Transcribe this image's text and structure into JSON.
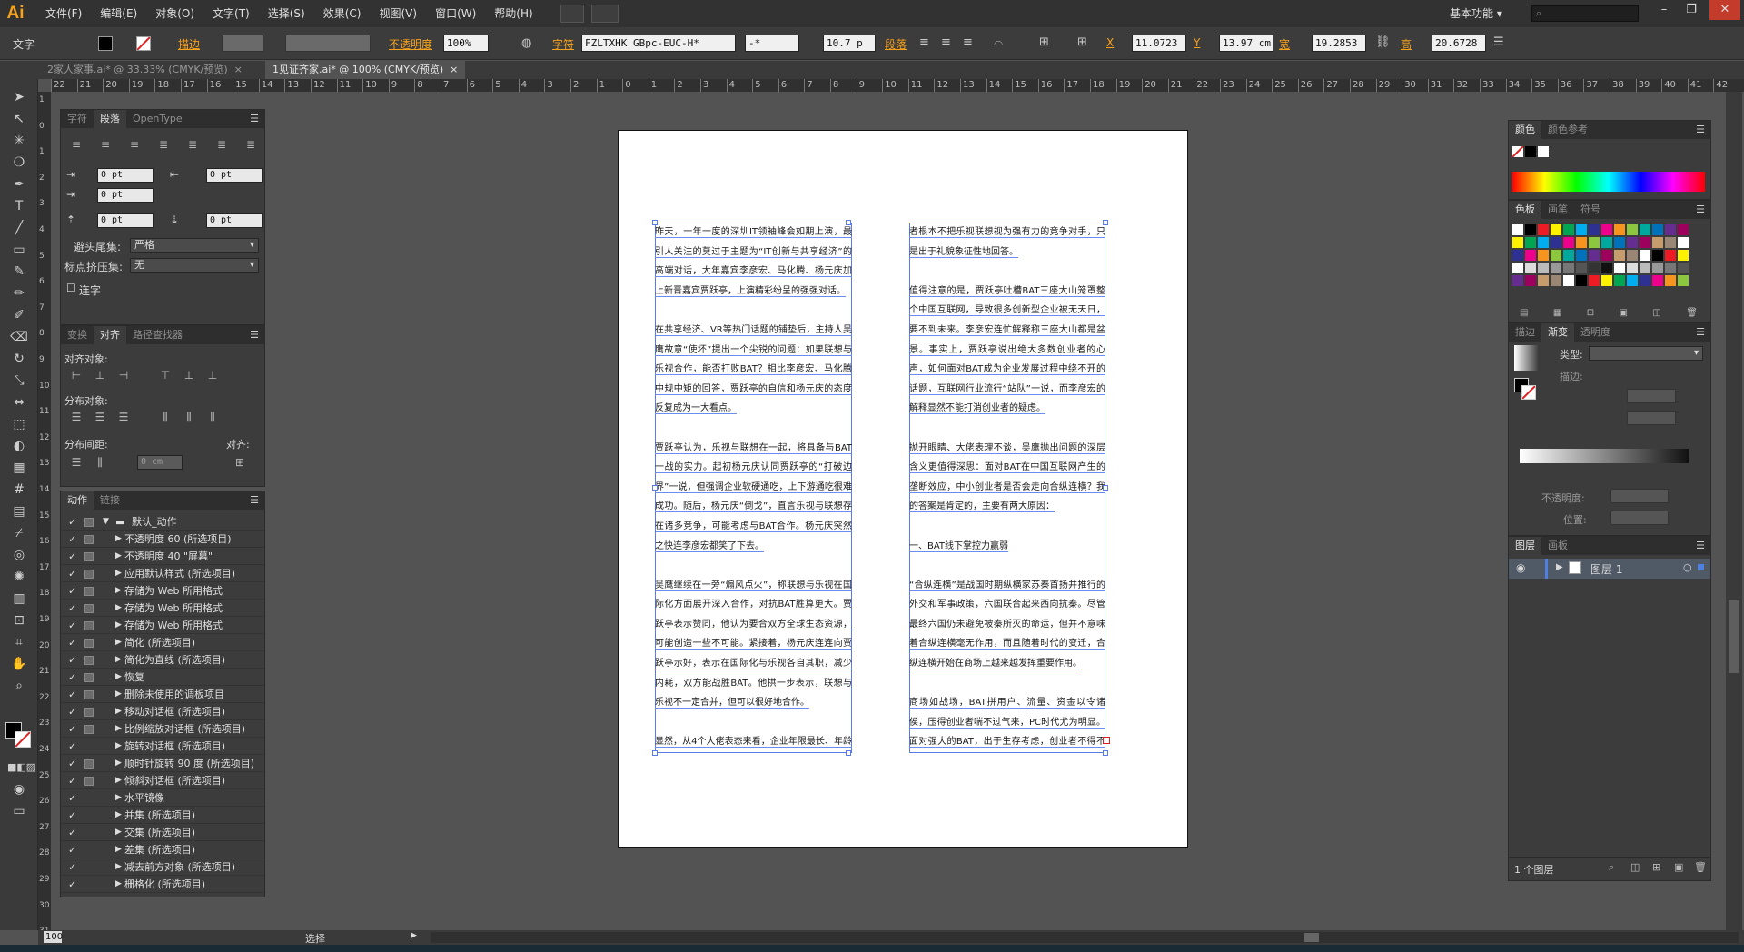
{
  "app": {
    "logo": "Ai"
  },
  "menu": [
    "文件(F)",
    "编辑(E)",
    "对象(O)",
    "文字(T)",
    "选择(S)",
    "效果(C)",
    "视图(V)",
    "窗口(W)",
    "帮助(H)"
  ],
  "workspace": "基本功能",
  "window_controls": [
    "–",
    "❐",
    "✕"
  ],
  "control": {
    "mode_label": "文字",
    "stroke_label": "描边",
    "opacity_label": "不透明度",
    "opacity_value": "100%",
    "font_label": "字符",
    "font_name": "FZLTXHK GBpc-EUC-H*",
    "font_style": "-*",
    "font_size": "10.7 p",
    "paragraph_label": "段落",
    "x_label": "X",
    "x_value": "11.0723",
    "y_label": "Y",
    "y_value": "13.97 cm",
    "w_label": "宽",
    "w_value": "19.2853",
    "h_label": "高",
    "h_value": "20.6728"
  },
  "tabs": [
    {
      "label": "2家人家事.ai* @ 33.33% (CMYK/预览)",
      "close": "×"
    },
    {
      "label": "1见证齐家.ai* @ 100% (CMYK/预览)",
      "close": "×"
    }
  ],
  "ruler": [
    "22",
    "21",
    "20",
    "19",
    "18",
    "17",
    "16",
    "15",
    "14",
    "13",
    "12",
    "11",
    "10",
    "9",
    "8",
    "7",
    "6",
    "5",
    "4",
    "3",
    "2",
    "1",
    "0",
    "1",
    "2",
    "3",
    "4",
    "5",
    "6",
    "7",
    "8",
    "9",
    "10",
    "11",
    "12",
    "13",
    "14",
    "15",
    "16",
    "17",
    "18",
    "19",
    "20",
    "21",
    "22",
    "23",
    "24",
    "25",
    "26",
    "27",
    "28",
    "29",
    "30",
    "31",
    "32",
    "33",
    "34",
    "35",
    "36",
    "37",
    "38",
    "39",
    "40",
    "41",
    "42"
  ],
  "vruler": [
    "1",
    "0",
    "1",
    "2",
    "3",
    "4",
    "5",
    "6",
    "7",
    "8",
    "9",
    "10",
    "11",
    "12",
    "13",
    "14",
    "15",
    "16",
    "17",
    "18",
    "19",
    "20",
    "21",
    "22",
    "23",
    "24",
    "25",
    "26",
    "27",
    "28",
    "29",
    "30",
    "31",
    "32",
    "33"
  ],
  "paragraph_panel": {
    "tabs": [
      "字符",
      "段落",
      "OpenType"
    ],
    "indent_left": "0 pt",
    "indent_right": "0 pt",
    "indent_first": "0 pt",
    "space_before": "0 pt",
    "space_after": "0 pt",
    "kinsoku_label": "避头尾集:",
    "kinsoku_value": "严格",
    "mojikumi_label": "标点挤压集:",
    "mojikumi_value": "无",
    "hyphen_label": "连字"
  },
  "align_panel": {
    "tabs": [
      "变换",
      "对齐",
      "路径查找器"
    ],
    "align_objects": "对齐对象:",
    "distribute_objects": "分布对象:",
    "distribute_spacing": "分布间距:",
    "align_to": "对齐:",
    "spacing_value": "0 cm"
  },
  "actions_panel": {
    "tabs": [
      "动作",
      "链接"
    ],
    "folder": "默认_动作",
    "items": [
      "不透明度 60 (所选项目)",
      "不透明度 40 \"屏幕\"",
      "应用默认样式 (所选项目)",
      "存储为 Web 所用格式",
      "存储为 Web 所用格式",
      "存储为 Web 所用格式",
      "简化 (所选项目)",
      "简化为直线 (所选项目)",
      "恢复",
      "删除未使用的调板项目",
      "移动对话框 (所选项目)",
      "比例缩放对话框 (所选项目)",
      "旋转对话框 (所选项目)",
      "顺时针旋转 90 度 (所选项目)",
      "倾斜对话框 (所选项目)",
      "水平镜像",
      "并集 (所选项目)",
      "交集 (所选项目)",
      "差集 (所选项目)",
      "减去前方对象 (所选项目)",
      "栅格化 (所选项目)"
    ]
  },
  "document": {
    "left_column": [
      "昨天，一年一度的深圳IT领袖峰会如期上演，最引人关注的莫过于主题为“IT创新与共享经济”的高端对话，大年嘉宾李彦宏、马化腾、杨元庆加上新晋嘉宾贾跃亭，上演精彩纷呈的强强对话。",
      "",
      "在共享经济、VR等热门话题的铺垫后，主持人吴鹰故意“使坏”提出一个尖锐的问题：如果联想与乐视合作，能否打败BAT？相比李彦宏、马化腾中规中矩的回答，贾跃亭的自信和杨元庆的态度反复成为一大看点。",
      "",
      "贾跃亭认为，乐视与联想在一起，将具备与BAT一战的实力。起初杨元庆认同贾跃亭的“打破边界”一说，但强调企业软硬通吃，上下游通吃很难成功。随后，杨元庆“倒戈”，直言乐视与联想存在诸多竞争，可能考虑与BAT合作。杨元庆突然之快连李彦宏都笑了下去。",
      "",
      "吴鹰继续在一旁“煽风点火”，称联想与乐视在国际化方面展开深入合作，对抗BAT胜算更大。贾跃亭表示赞同，他认为要合双方全球生态资源，可能创造一些不可能。紧接着，杨元庆连连向贾跃亭示好，表示在国际化与乐视各自其职，减少内耗，双方能战胜BAT。他拱一步表示，联想与乐视不一定合并，但可以很好地合作。",
      "",
      "显然，从4个大佬表态来看，企业年限最长、年龄最大的杨元庆是输家，尽管吴鹰尖锐，假设性提问更多是出于吸引眼球考虑，但杨元庆的表现差强人意，既没有后者贾跃亭的坚持，也没有李彦宏、马化腾的淡定，或许他后"
    ],
    "right_column": [
      "者根本不把乐视联想视为强有力的竞争对手，只是出于礼貌象征性地回答。",
      "",
      "值得注意的是，贾跃亭吐槽BAT三座大山笼罩整个中国互联网，导致很多创新型企业被无天日，要不到未来。李彦宏连忙解释称三座大山都是盆景。事实上，贾跃亭说出绝大多数创业者的心声，如何面对BAT成为企业发展过程中绕不开的话题，互联网行业流行“站队”一说，而李彦宏的解释显然不能打消创业者的疑虑。",
      "",
      "抛开眼睛、大佬表理不谈，吴鹰抛出问题的深层含义更值得深思：面对BAT在中国互联网产生的垄断效应，中小创业者是否会走向合纵连横？我的答案是肯定的，主要有两大原因：",
      "",
      "一、BAT线下掌控力赢弱",
      "",
      "“合纵连横”是战国时期纵横家苏秦首扬并推行的外交和军事政策，六国联合起来西向抗秦。尽管最终六国仍未避免被秦所灭的命运，但并不意味着合纵连横毫无作用，而且随着时代的变迁，合纵连横开始在商场上越来越发挥重要作用。",
      "",
      "商场如战场，BAT拼用户、流量、资金以令诸侯，压得创业者喘不过气来，PC时代尤为明显。面对强大的BAT，出于生存考虑，创业者不得不做出艰难选择，正如贾跃亭所言，在BAT的阴影笼罩下，创业者只有三条"
    ]
  },
  "color_panel": {
    "tabs": [
      "颜色",
      "颜色参考"
    ]
  },
  "swatch_panel": {
    "tabs": [
      "色板",
      "画笔",
      "符号"
    ]
  },
  "gradient_panel": {
    "tabs": [
      "描边",
      "渐变",
      "透明度"
    ],
    "type_label": "类型:",
    "stroke_label": "描边:",
    "opacity_label": "不透明度:",
    "position_label": "位置:"
  },
  "layers_panel": {
    "tabs": [
      "图层",
      "画板"
    ],
    "layer_name": "图层 1",
    "count": "1 个图层"
  },
  "status": {
    "zoom": "100",
    "mode": "选择"
  },
  "colors": {
    "accent": "#f7a21b",
    "selection": "#5a7ae8"
  }
}
